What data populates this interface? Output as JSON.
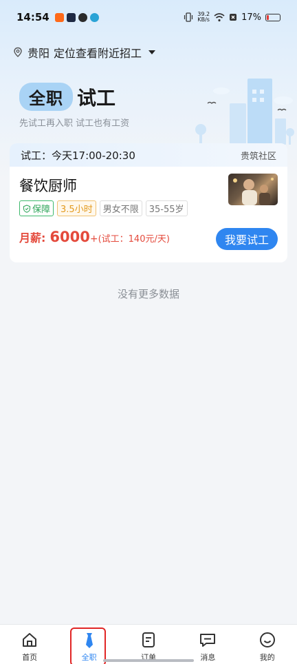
{
  "status_bar": {
    "time": "14:54",
    "net_speed_value": "39.2",
    "net_speed_unit": "KB/s",
    "battery_percent": "17%",
    "battery_level": 0.17,
    "app_icon_colors": [
      "#ff6a1a",
      "#1f2a44",
      "#2b2b2b",
      "#2aa3d6"
    ]
  },
  "location": {
    "city": "贵阳",
    "prompt": "定位查看附近招工"
  },
  "hero": {
    "pill_text": "全职",
    "title_word": "试工",
    "subtitle": "先试工再入职 试工也有工资"
  },
  "job_card": {
    "trial_time": "试工：今天17:00-20:30",
    "area": "贵筑社区",
    "title": "餐饮厨师",
    "tags": [
      "保障",
      "3.5小时",
      "男女不限",
      "35-55岁"
    ],
    "salary_label": "月薪:",
    "salary_amount": "6000",
    "salary_plus": "+",
    "trial_pay": "(试工：140元/天)",
    "apply_label": "我要试工"
  },
  "list_footer": "没有更多数据",
  "bottom_nav": [
    {
      "label": "首页",
      "icon": "home-icon"
    },
    {
      "label": "全职",
      "icon": "tie-icon"
    },
    {
      "label": "订单",
      "icon": "document-icon"
    },
    {
      "label": "消息",
      "icon": "message-icon"
    },
    {
      "label": "我的",
      "icon": "smile-icon"
    }
  ],
  "colors": {
    "accent": "#2f86f0",
    "salary": "#e44a3c",
    "highlight_border": "#e02424"
  }
}
